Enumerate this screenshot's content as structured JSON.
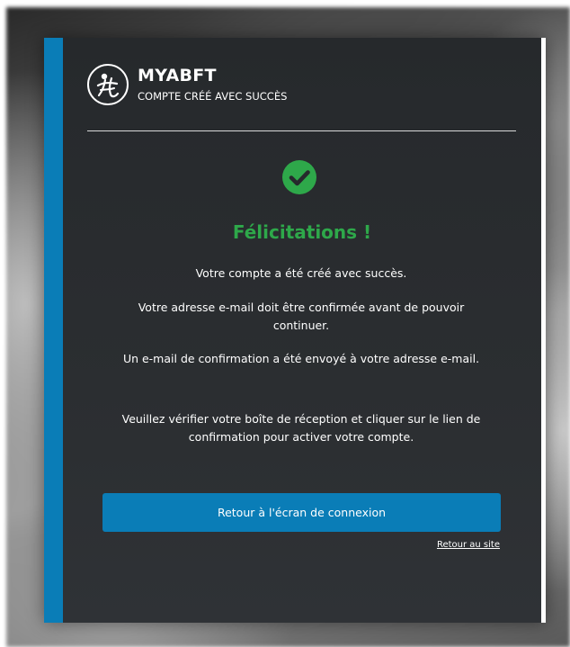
{
  "brand": {
    "name": "MYABFT",
    "subtitle": "COMPTE CRÉÉ AVEC SUCCÈS",
    "logo_icon": "figure-in-circle-logo-icon"
  },
  "success": {
    "icon": "check-circle-icon",
    "title": "Félicitations !",
    "messages": [
      "Votre compte a été créé avec succès.",
      "Votre adresse e-mail doit être confirmée avant de pouvoir continuer.",
      "Un e-mail de confirmation a été envoyé à votre adresse e-mail.",
      "Veuillez vérifier votre boîte de réception et cliquer sur le lien de confirmation pour activer votre compte."
    ]
  },
  "actions": {
    "login_button": "Retour à l'écran de connexion",
    "site_link": "Retour au site"
  },
  "colors": {
    "accent_blue": "#0a7db7",
    "success_green": "#2ea84a",
    "card_bg": "#2b2e31"
  }
}
